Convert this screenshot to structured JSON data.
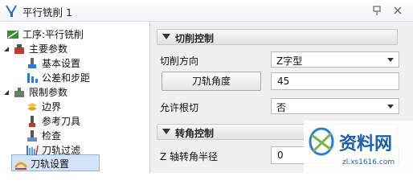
{
  "window": {
    "title": "平行铣削 1",
    "pin_icon": "pin-icon",
    "close_icon": "close-icon"
  },
  "tree": {
    "root": "工序:平行铣削",
    "items": [
      {
        "label": "主要参数",
        "icon": "main-params-icon"
      },
      {
        "label": "基本设置",
        "icon": "basic-settings-icon"
      },
      {
        "label": "公差和步距",
        "icon": "tolerance-icon"
      },
      {
        "label": "限制参数",
        "icon": "limit-params-icon"
      },
      {
        "label": "边界",
        "icon": "boundary-icon"
      },
      {
        "label": "参考刀具",
        "icon": "reference-tool-icon"
      },
      {
        "label": "检查",
        "icon": "check-icon"
      },
      {
        "label": "刀轨过滤",
        "icon": "toolpath-filter-icon"
      },
      {
        "label": "刀轨设置",
        "icon": "toolpath-settings-icon",
        "selected": true
      }
    ]
  },
  "panel": {
    "cutting_control": {
      "header": "切削控制",
      "cut_direction_label": "切削方向",
      "cut_direction_value": "Z字型",
      "toolpath_angle_button": "刀轨角度",
      "toolpath_angle_value": "45",
      "allow_root_cut_label": "允许根切",
      "allow_root_cut_value": "否"
    },
    "corner_control": {
      "header": "转角控制",
      "z_radius_label": "Z 轴转角半径",
      "z_radius_value": "0"
    }
  },
  "watermark": {
    "brand": "资料网",
    "url": "zl.xs1616.com"
  }
}
